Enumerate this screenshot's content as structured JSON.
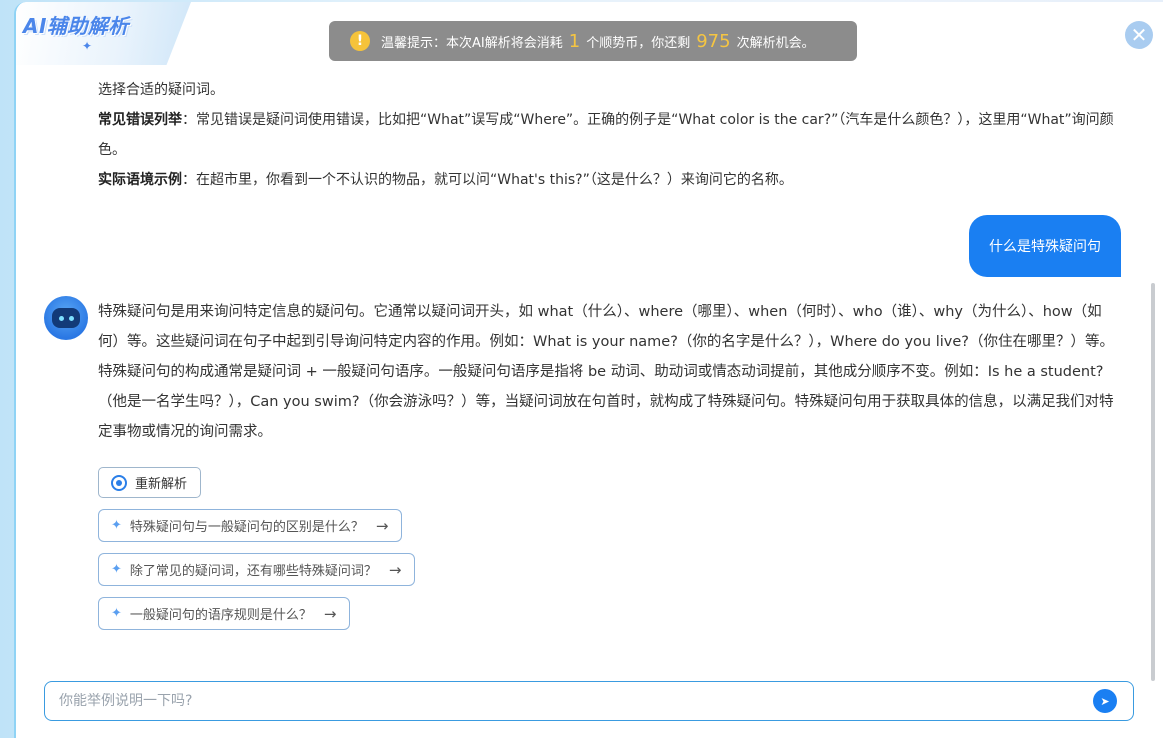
{
  "header": {
    "logo_text": "AI辅助解析",
    "close_icon": "close-icon"
  },
  "toast": {
    "icon": "warning-icon",
    "prefix": "温馨提示：本次AI解析将会消耗",
    "cost": "1",
    "middle": "个顺势币，你还剩",
    "remaining": "975",
    "suffix": "次解析机会。"
  },
  "previous_answer": {
    "line1": "选择合适的疑问词。",
    "error_label": "常见错误列举",
    "error_text": "：常见错误是疑问词使用错误，比如把“What”误写成“Where”。正确的例子是“What color is the car?”（汽车是什么颜色？），这里用“What”询问颜色。",
    "example_label": "实际语境示例",
    "example_text": "：在超市里，你看到一个不认识的物品，就可以问“What's this?”（这是什么？）来询问它的名称。"
  },
  "user_message": "什么是特殊疑问句",
  "answer": "特殊疑问句是用来询问特定信息的疑问句。它通常以疑问词开头，如 what（什么）、where（哪里）、when（何时）、who（谁）、why（为什么）、how（如何）等。这些疑问词在句子中起到引导询问特定内容的作用。例如：What is your name?（你的名字是什么？），Where do you live?（你住在哪里？）等。特殊疑问句的构成通常是疑问词 + 一般疑问句语序。一般疑问句语序是指将 be 动词、助动词或情态动词提前，其他成分顺序不变。例如：Is he a student?（他是一名学生吗？），Can you swim?（你会游泳吗？）等，当疑问词放在句首时，就构成了特殊疑问句。特殊疑问句用于获取具体的信息，以满足我们对特定事物或情况的询问需求。",
  "actions": {
    "regenerate_label": "重新解析"
  },
  "suggestions": [
    {
      "label": "特殊疑问句与一般疑问句的区别是什么？"
    },
    {
      "label": "除了常见的疑问词，还有哪些特殊疑问词？"
    },
    {
      "label": "一般疑问句的语序规则是什么？"
    }
  ],
  "input": {
    "placeholder": "你能举例说明一下吗?",
    "value": ""
  },
  "colors": {
    "accent": "#1a7ff2",
    "toast_number": "#f5c542"
  }
}
